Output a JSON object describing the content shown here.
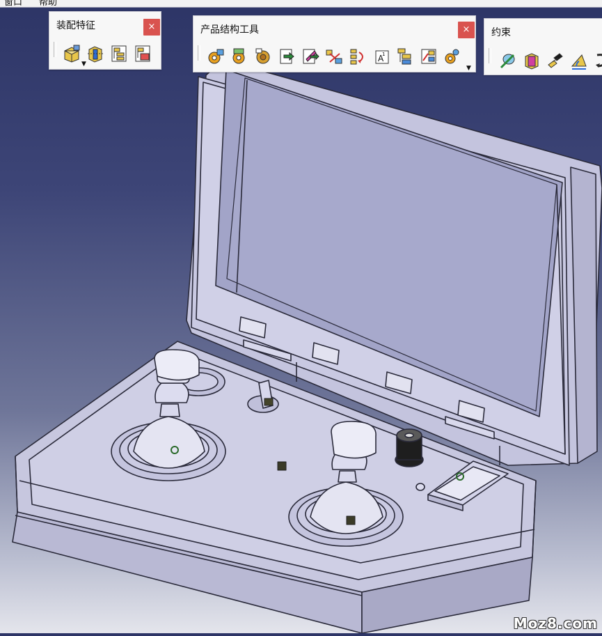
{
  "menubar": {
    "items": [
      "窗口",
      "帮助"
    ]
  },
  "toolbars": {
    "assembly_features": {
      "title": "装配特征",
      "close_label": "×",
      "icons": [
        "assembly-split-icon",
        "assembly-hole-icon",
        "assembly-pocket-icon",
        "assembly-remove-icon"
      ]
    },
    "product_structure": {
      "title": "产品结构工具",
      "close_label": "×",
      "icons": [
        "insert-component-icon",
        "insert-product-icon",
        "insert-part-icon",
        "existing-component-icon",
        "existing-component-positioning-icon",
        "replace-component-icon",
        "graph-tree-reordering-icon",
        "generate-numbering-icon",
        "selective-load-icon",
        "manage-representations-icon",
        "multi-instantiation-icon"
      ]
    },
    "constraints": {
      "title": "约束",
      "icons": [
        "coincidence-constraint-icon",
        "contact-constraint-icon",
        "offset-constraint-icon",
        "angle-constraint-icon",
        "fix-component-icon"
      ]
    }
  },
  "viewport": {
    "model": "handheld-console-assembly",
    "colors": {
      "background_top": "#2d3566",
      "background_bottom": "#e4e5ec",
      "model_face": "#c7c7e0",
      "model_edge": "#2a2a3a"
    }
  },
  "watermark": "Moz8.com"
}
